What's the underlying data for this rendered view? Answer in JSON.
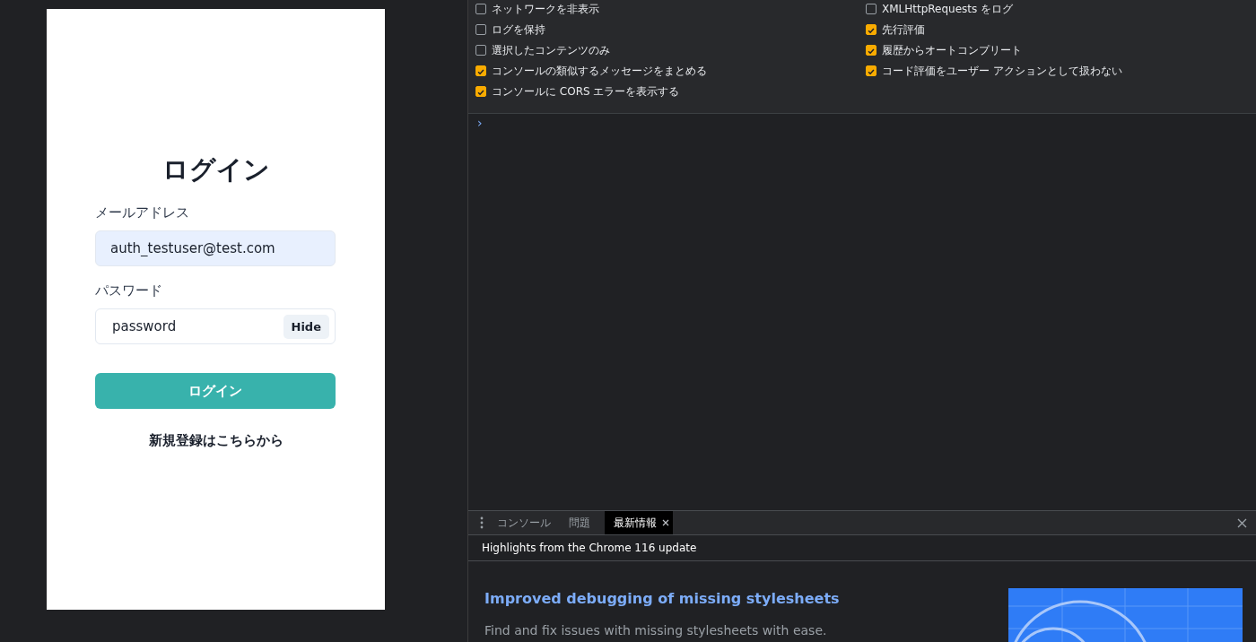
{
  "login": {
    "title": "ログイン",
    "email_label": "メールアドレス",
    "email_value": "auth_testuser@test.com",
    "password_label": "パスワード",
    "password_value": "password",
    "toggle_button": "Hide",
    "submit_button": "ログイン",
    "register_link": "新規登録はこちらから"
  },
  "settings": {
    "left": [
      {
        "label": "ネットワークを非表示",
        "checked": false
      },
      {
        "label": "ログを保持",
        "checked": false
      },
      {
        "label": "選択したコンテンツのみ",
        "checked": false
      },
      {
        "label": "コンソールの類似するメッセージをまとめる",
        "checked": true
      },
      {
        "label": "コンソールに CORS エラーを表示する",
        "checked": true
      }
    ],
    "right": [
      {
        "label": "XMLHttpRequests をログ",
        "checked": false
      },
      {
        "label": "先行評価",
        "checked": true
      },
      {
        "label": "履歴からオートコンプリート",
        "checked": true
      },
      {
        "label": "コード評価をユーザー アクションとして扱わない",
        "checked": true
      }
    ]
  },
  "console": {
    "prompt": "›"
  },
  "drawer": {
    "tabs": [
      {
        "label": "コンソール",
        "selected": false,
        "closable": false
      },
      {
        "label": "問題",
        "selected": false,
        "closable": false
      },
      {
        "label": "最新情報",
        "selected": true,
        "closable": true
      }
    ],
    "header": "Highlights from the Chrome 116 update",
    "article_title": "Improved debugging of missing stylesheets",
    "article_text": "Find and fix issues with missing stylesheets with ease."
  }
}
